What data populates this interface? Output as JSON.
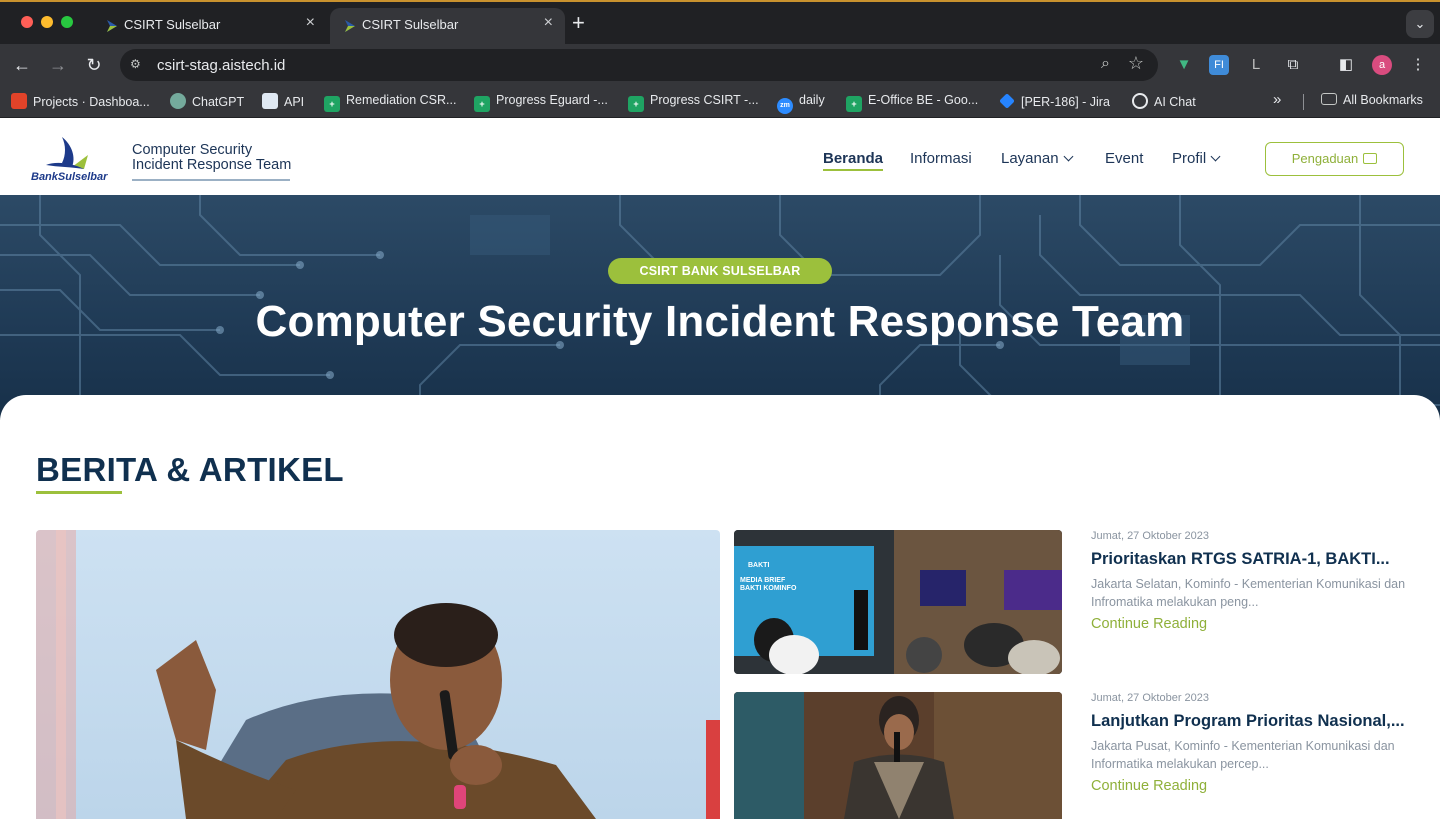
{
  "browser": {
    "tabs": [
      {
        "title": "CSIRT Sulselbar",
        "active": false
      },
      {
        "title": "CSIRT Sulselbar",
        "active": true
      }
    ],
    "new_tab_icon": "plus-icon",
    "url": "csirt-stag.aistech.id",
    "profile_initial": "a",
    "bookmarks": [
      {
        "label": "Projects · Dashboa...",
        "icon": "gitlab-icon",
        "color": "#e24329"
      },
      {
        "label": "ChatGPT",
        "icon": "chatgpt-icon",
        "color": "#74aa9c"
      },
      {
        "label": "API",
        "icon": "api-icon",
        "color": "#3b82c4"
      },
      {
        "label": "Remediation CSR...",
        "icon": "sheets-icon",
        "color": "#1fa463"
      },
      {
        "label": "Progress Eguard -...",
        "icon": "sheets-icon",
        "color": "#1fa463"
      },
      {
        "label": "Progress CSIRT -...",
        "icon": "sheets-icon",
        "color": "#1fa463"
      },
      {
        "label": "daily",
        "icon": "zoom-icon",
        "color": "#2d8cff"
      },
      {
        "label": "E-Office BE - Goo...",
        "icon": "sheets-icon",
        "color": "#1fa463"
      },
      {
        "label": "[PER-186] - Jira",
        "icon": "jira-icon",
        "color": "#2684ff"
      },
      {
        "label": "AI Chat",
        "icon": "ai-chat-icon",
        "color": "#e8eaed"
      }
    ],
    "all_bookmarks": "All Bookmarks"
  },
  "site": {
    "logo_brand": "BankSulselbar",
    "logo_title_line1": "Computer Security",
    "logo_title_line2": "Incident Response Team",
    "nav": [
      {
        "label": "Beranda",
        "active": true,
        "dropdown": false
      },
      {
        "label": "Informasi",
        "active": false,
        "dropdown": false
      },
      {
        "label": "Layanan",
        "active": false,
        "dropdown": true
      },
      {
        "label": "Event",
        "active": false,
        "dropdown": false
      },
      {
        "label": "Profil",
        "active": false,
        "dropdown": true
      }
    ],
    "complaint_button": "Pengaduan"
  },
  "hero": {
    "badge": "CSIRT BANK SULSELBAR",
    "title": "Computer Security Incident Response Team"
  },
  "news": {
    "section_title": "BERITA & ARTIKEL",
    "articles": [
      {
        "date": "Jumat, 27 Oktober 2023",
        "headline": "Prioritaskan RTGS SATRIA-1, BAKTI...",
        "excerpt": "Jakarta Selatan, Kominfo - Kementerian Komunikasi dan Infromatika melakukan peng...",
        "more": "Continue Reading"
      },
      {
        "date": "Jumat, 27 Oktober 2023",
        "headline": "Lanjutkan Program Prioritas Nasional,...",
        "excerpt": "Jakarta Pusat, Kominfo - Kementerian Komunikasi dan Informatika melakukan percep...",
        "more": "Continue Reading"
      }
    ],
    "thumb_screen_text_1": "MEDIA BRIEF",
    "thumb_screen_text_2": "BAKTI KOMINFO",
    "thumb_logo": "BAKTI"
  },
  "colors": {
    "accent_green": "#9cc03c",
    "navy": "#10304f",
    "chrome_dark": "#202124",
    "chrome_mid": "#35363a"
  }
}
